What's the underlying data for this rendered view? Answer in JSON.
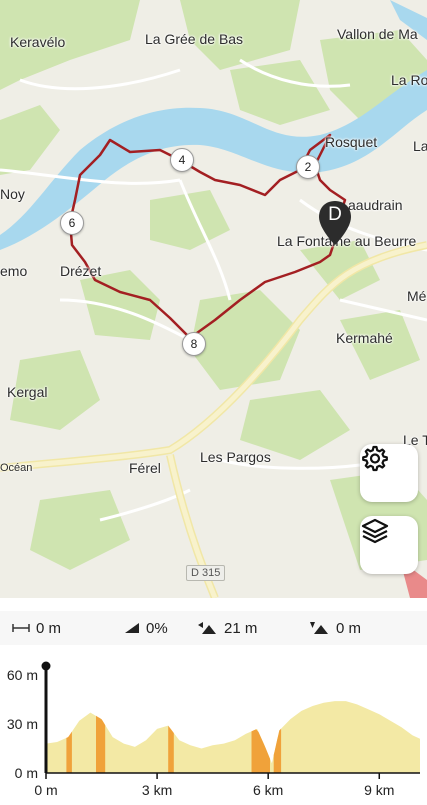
{
  "map": {
    "places": [
      {
        "name": "Keravélo"
      },
      {
        "name": "La Grée de Bas"
      },
      {
        "name": "Vallon de Ma"
      },
      {
        "name": "La Ro"
      },
      {
        "name": "Rosquet"
      },
      {
        "name": "La"
      },
      {
        "name": "aaudrain"
      },
      {
        "name": "Noy"
      },
      {
        "name": "La Fontaine au Beurre"
      },
      {
        "name": "emo"
      },
      {
        "name": "Drézet"
      },
      {
        "name": "Mé"
      },
      {
        "name": "Kermahé"
      },
      {
        "name": "Kergal"
      },
      {
        "name": "Le T"
      },
      {
        "name": "Océan"
      },
      {
        "name": "Férel"
      },
      {
        "name": "Les Pargos"
      }
    ],
    "waypoints": [
      "2",
      "4",
      "6",
      "8"
    ],
    "destination_marker": "D",
    "road_shield": "D 315",
    "colors": {
      "route": "#a31f22",
      "river": "#a8d8ee",
      "forest": "#cfe4b0",
      "road": "#f6f0c4"
    }
  },
  "controls": {
    "settings_icon": "gear-icon",
    "layers_icon": "layers-icon"
  },
  "stats": {
    "distance": "0 m",
    "slope": "0%",
    "ascent": "21 m",
    "descent": "0 m"
  },
  "profile": {
    "y_ticks": [
      "60 m",
      "30 m",
      "0 m"
    ],
    "x_ticks": [
      "0 m",
      "3 km",
      "6 km",
      "9 km"
    ]
  },
  "chart_data": {
    "type": "area",
    "xlabel": "",
    "ylabel": "",
    "ylim": [
      0,
      60
    ],
    "xlim": [
      0,
      10.1
    ],
    "x_ticks": [
      "0 m",
      "3 km",
      "6 km",
      "9 km"
    ],
    "y_ticks": [
      "60 m",
      "30 m",
      "0 m"
    ],
    "grid": false,
    "series": [
      {
        "x": [
          0,
          0.3,
          0.6,
          0.9,
          1.2,
          1.5,
          1.8,
          2.1,
          2.4,
          2.7,
          3.0,
          3.3,
          3.6,
          3.9,
          4.2,
          4.5,
          4.8,
          5.1,
          5.4,
          5.7,
          5.9,
          6.1,
          6.3,
          6.6,
          6.9,
          7.2,
          7.5,
          7.8,
          8.1,
          8.4,
          8.7,
          9.0,
          9.3,
          9.6,
          9.9,
          10.1
        ],
        "values": [
          18,
          19,
          22,
          32,
          37,
          33,
          22,
          18,
          16,
          20,
          27,
          29,
          20,
          17,
          15,
          17,
          18,
          20,
          24,
          27,
          17,
          6,
          26,
          33,
          38,
          41,
          43,
          44,
          44,
          42,
          39,
          36,
          32,
          28,
          23,
          21
        ]
      }
    ],
    "steep_segments": [
      [
        0.55,
        0.7
      ],
      [
        1.35,
        1.6
      ],
      [
        3.3,
        3.45
      ],
      [
        5.55,
        6.05
      ],
      [
        6.15,
        6.35
      ]
    ]
  }
}
